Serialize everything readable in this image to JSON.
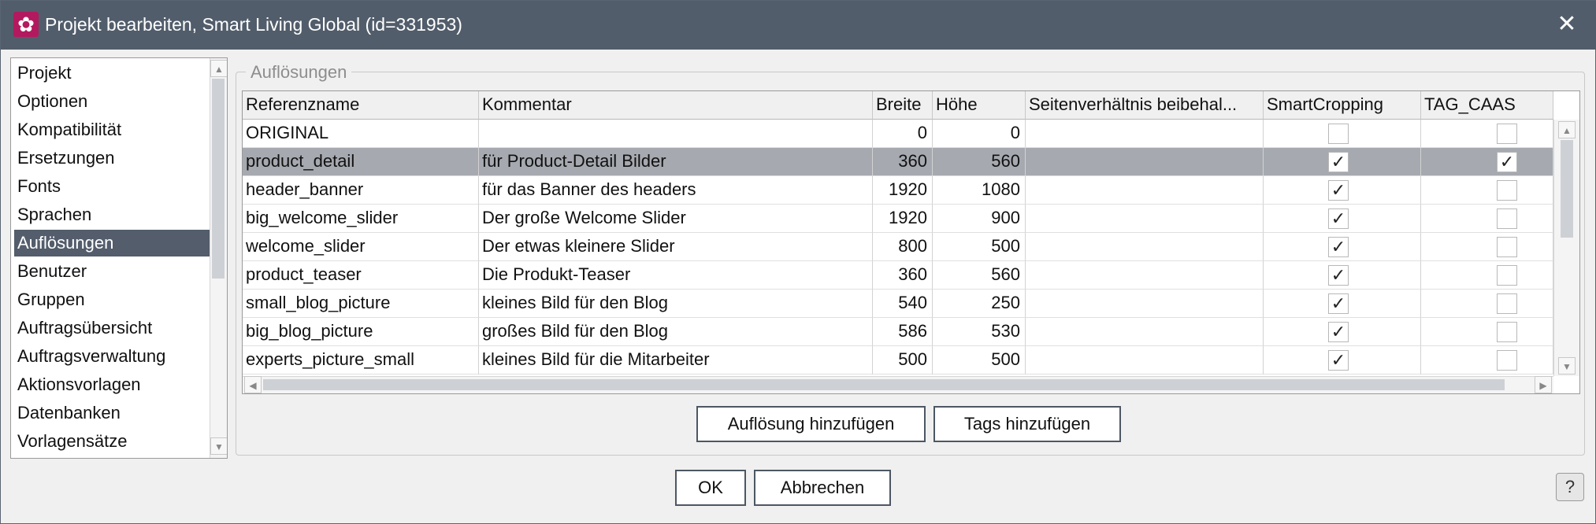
{
  "window": {
    "title": "Projekt bearbeiten, Smart Living Global (id=331953)",
    "app_icon": "gear-icon",
    "close_icon": "close-icon",
    "close_glyph": "✕",
    "icon_glyph": "✿"
  },
  "sidebar": {
    "items": [
      {
        "label": "Projekt"
      },
      {
        "label": "Optionen"
      },
      {
        "label": "Kompatibilität"
      },
      {
        "label": "Ersetzungen"
      },
      {
        "label": "Fonts"
      },
      {
        "label": "Sprachen"
      },
      {
        "label": "Auflösungen"
      },
      {
        "label": "Benutzer"
      },
      {
        "label": "Gruppen"
      },
      {
        "label": "Auftragsübersicht"
      },
      {
        "label": "Auftragsverwaltung"
      },
      {
        "label": "Aktionsvorlagen"
      },
      {
        "label": "Datenbanken"
      },
      {
        "label": "Vorlagensätze"
      }
    ],
    "selected": "Auflösungen"
  },
  "panel": {
    "legend": "Auflösungen",
    "columns": [
      "Referenzname",
      "Kommentar",
      "Breite",
      "Höhe",
      "Seitenverhältnis beibehal...",
      "SmartCropping",
      "TAG_CAAS"
    ],
    "rows": [
      {
        "name": "ORIGINAL",
        "comment": "",
        "width": "0",
        "height": "0",
        "keep_ratio": false,
        "smart_cropping": false,
        "tag_caas": false
      },
      {
        "name": "product_detail",
        "comment": "für Product-Detail Bilder",
        "width": "360",
        "height": "560",
        "keep_ratio": false,
        "smart_cropping": true,
        "tag_caas": true
      },
      {
        "name": "header_banner",
        "comment": "für das Banner des headers",
        "width": "1920",
        "height": "1080",
        "keep_ratio": false,
        "smart_cropping": true,
        "tag_caas": false
      },
      {
        "name": "big_welcome_slider",
        "comment": "Der große Welcome Slider",
        "width": "1920",
        "height": "900",
        "keep_ratio": false,
        "smart_cropping": true,
        "tag_caas": false
      },
      {
        "name": "welcome_slider",
        "comment": "Der etwas kleinere Slider",
        "width": "800",
        "height": "500",
        "keep_ratio": false,
        "smart_cropping": true,
        "tag_caas": false
      },
      {
        "name": "product_teaser",
        "comment": "Die Produkt-Teaser",
        "width": "360",
        "height": "560",
        "keep_ratio": false,
        "smart_cropping": true,
        "tag_caas": false
      },
      {
        "name": "small_blog_picture",
        "comment": "kleines Bild für den Blog",
        "width": "540",
        "height": "250",
        "keep_ratio": false,
        "smart_cropping": true,
        "tag_caas": false
      },
      {
        "name": "big_blog_picture",
        "comment": "großes Bild für den Blog",
        "width": "586",
        "height": "530",
        "keep_ratio": false,
        "smart_cropping": true,
        "tag_caas": false
      },
      {
        "name": "experts_picture_small",
        "comment": "kleines Bild für die Mitarbeiter",
        "width": "500",
        "height": "500",
        "keep_ratio": false,
        "smart_cropping": true,
        "tag_caas": false
      }
    ],
    "selected_row": "product_detail",
    "check_glyph": "✓",
    "add_resolution_button": "Auflösung hinzufügen",
    "add_tags_button": "Tags hinzufügen"
  },
  "footer": {
    "ok_button": "OK",
    "cancel_button": "Abbrechen",
    "help_label": "?"
  }
}
